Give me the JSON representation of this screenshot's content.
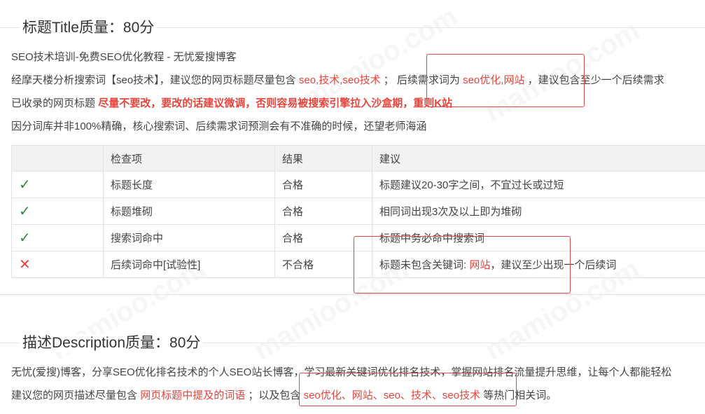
{
  "title_section": {
    "heading": "标题Title质量：80分",
    "page_title": "SEO技术培训-免费SEO优化教程 - 无忧爱搜博客",
    "analysis": {
      "p1": "经摩天楼分析搜索词【seo技术】，建议您的网页标题尽量包含",
      "keywords": "seo,技术,seo技术",
      "p2": "；  后续需求词为",
      "followup": "seo优化,网站",
      "p3": "，建议包含至少一个后续需求"
    },
    "indexed": {
      "prefix": "已收录的网页标题",
      "warning": "尽量不要改，要改的话建议微调，否则容易被搜索引擎拉入沙盒期，重则K站"
    },
    "disclaimer": "因分词库并非100%精确，核心搜索词、后续需求词预测会有不准确的时候，还望老师海涵",
    "table": {
      "headers": [
        "",
        "检查项",
        "结果",
        "建议"
      ],
      "rows": [
        {
          "status": "✓",
          "item": "标题长度",
          "result": "合格",
          "advice": "标题建议20-30字之间，不宜过长或过短"
        },
        {
          "status": "✓",
          "item": "标题堆砌",
          "result": "合格",
          "advice": "相同词出现3次及以上即为堆砌"
        },
        {
          "status": "✓",
          "item": "搜索词命中",
          "result": "合格",
          "advice": "标题中务必命中搜索词"
        },
        {
          "status": "✕",
          "item": "后续词命中[试验性]",
          "result": "不合格",
          "advice_prefix": "标题未包含关键词:",
          "advice_keyword": "网站",
          "advice_suffix": "，建议至少出现一个后续词"
        }
      ]
    }
  },
  "description_section": {
    "heading": "描述Description质量：80分",
    "description": "无忧(爱搜)博客，分享SEO优化排名技术的个人SEO站长博客，学习最新关键词优化排名技术，掌握网站排名流量提升思维，让每个人都能轻松",
    "advice": {
      "p1": "建议您的网页描述尽量包含",
      "title_terms": "网页标题中提及的词语",
      "p2": "；以及包含",
      "keywords": "seo优化、网站、seo、技术、seo技术",
      "p3": "等热门相关词。"
    }
  },
  "watermark": "mamioo.com",
  "colors": {
    "accent_red": "#e8453c",
    "check_green": "#2e8b3a",
    "header_bg": "#f2f2f2"
  }
}
